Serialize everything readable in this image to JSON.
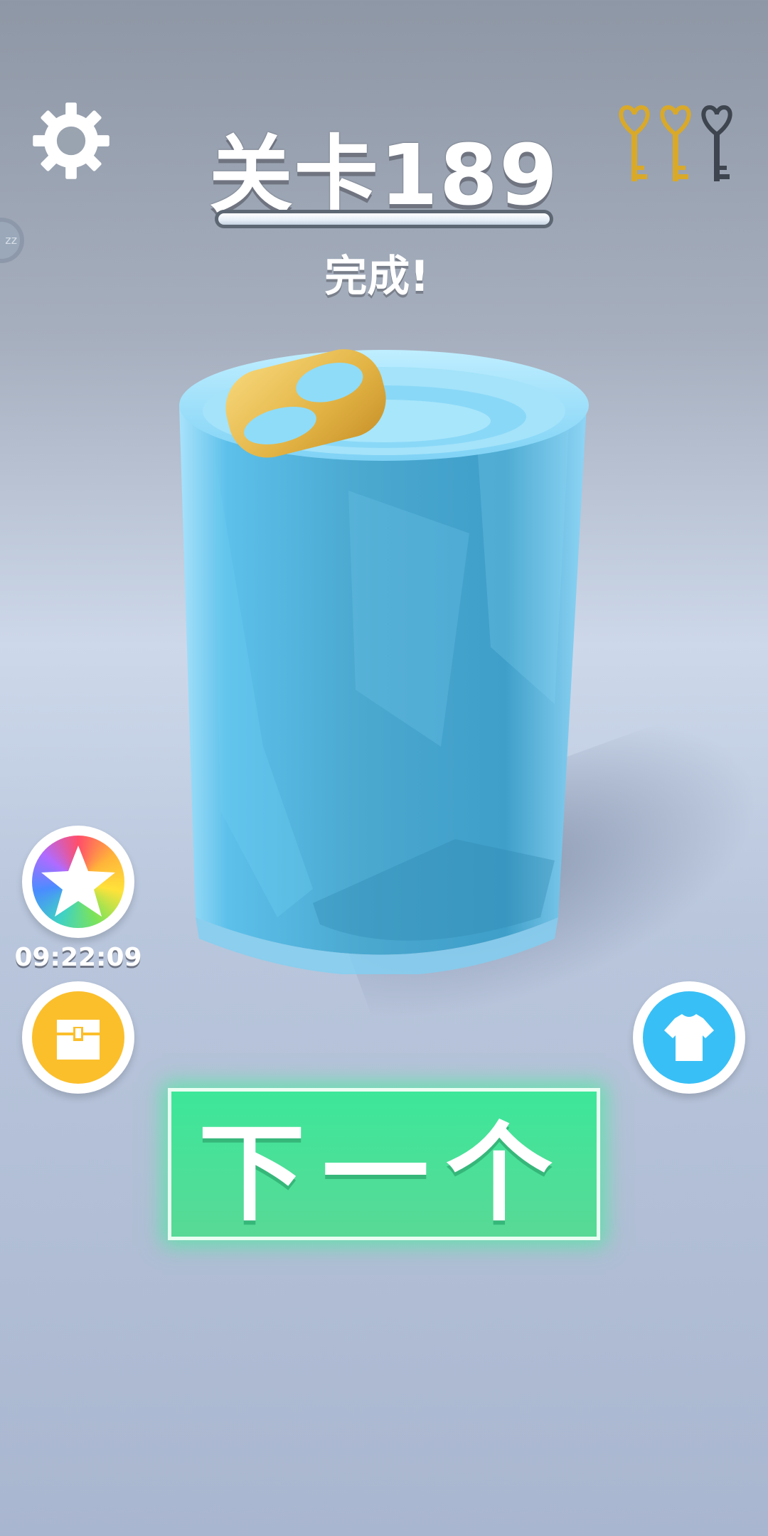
{
  "header": {
    "level_title": "关卡189",
    "status_text": "完成!"
  },
  "level_progress": 1.0,
  "keys": {
    "collected": 2,
    "total": 3,
    "gold_color": "#d9a92a",
    "empty_color": "#3e454f"
  },
  "side_buttons": {
    "timer": "09:22:09"
  },
  "next_button": {
    "label": "下一个"
  },
  "colors": {
    "accent_green": "#3de79a",
    "chest_yellow": "#fbbf2c",
    "shirt_blue": "#38bff6"
  },
  "icons": [
    "gear-icon",
    "sleep-icon",
    "key-icon",
    "star-icon",
    "chest-icon",
    "shirt-icon"
  ]
}
